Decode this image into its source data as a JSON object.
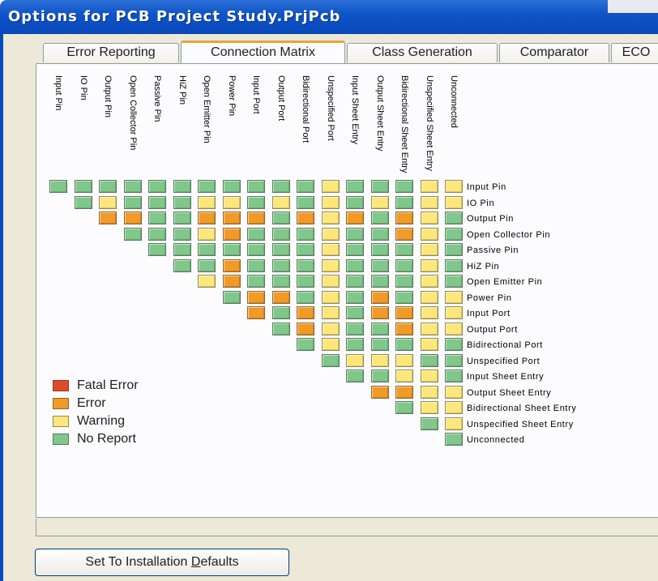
{
  "window": {
    "title": "Options for PCB Project Study.PrjPcb"
  },
  "tabs": [
    {
      "label": "Error Reporting",
      "active": false
    },
    {
      "label": "Connection Matrix",
      "active": true
    },
    {
      "label": "Class Generation",
      "active": false
    },
    {
      "label": "Comparator",
      "active": false
    },
    {
      "label": "ECO",
      "active": false
    }
  ],
  "matrix": {
    "columns": [
      "Input Pin",
      "IO Pin",
      "Output Pin",
      "Open Collector Pin",
      "Passive Pin",
      "HiZ Pin",
      "Open Emitter Pin",
      "Power Pin",
      "Input Port",
      "Output Port",
      "Bidirectional Port",
      "Unspecified Port",
      "Input Sheet Entry",
      "Output Sheet Entry",
      "Bidirectional Sheet Entry",
      "Unspecified Sheet Entry",
      "Unconnected"
    ],
    "rows": [
      "Input Pin",
      "IO Pin",
      "Output Pin",
      "Open Collector Pin",
      "Passive Pin",
      "HiZ Pin",
      "Open Emitter Pin",
      "Power Pin",
      "Input Port",
      "Output Port",
      "Bidirectional Port",
      "Unspecified Port",
      "Input Sheet Entry",
      "Output Sheet Entry",
      "Bidirectional Sheet Entry",
      "Unspecified Sheet Entry",
      "Unconnected"
    ],
    "cells": [
      [
        "N",
        "N",
        "N",
        "N",
        "N",
        "N",
        "N",
        "N",
        "N",
        "N",
        "N",
        "W",
        "N",
        "N",
        "N",
        "W",
        "W"
      ],
      [
        "",
        "N",
        "W",
        "N",
        "N",
        "N",
        "W",
        "W",
        "N",
        "W",
        "N",
        "W",
        "N",
        "W",
        "N",
        "W",
        "W"
      ],
      [
        "",
        "",
        "E",
        "E",
        "N",
        "N",
        "E",
        "E",
        "E",
        "N",
        "E",
        "W",
        "E",
        "N",
        "E",
        "W",
        "N"
      ],
      [
        "",
        "",
        "",
        "N",
        "N",
        "N",
        "W",
        "E",
        "N",
        "N",
        "N",
        "W",
        "N",
        "N",
        "E",
        "W",
        "N"
      ],
      [
        "",
        "",
        "",
        "",
        "N",
        "N",
        "N",
        "N",
        "N",
        "N",
        "N",
        "W",
        "N",
        "N",
        "N",
        "W",
        "N"
      ],
      [
        "",
        "",
        "",
        "",
        "",
        "N",
        "N",
        "E",
        "N",
        "N",
        "N",
        "W",
        "N",
        "N",
        "N",
        "W",
        "N"
      ],
      [
        "",
        "",
        "",
        "",
        "",
        "",
        "W",
        "E",
        "N",
        "N",
        "N",
        "W",
        "N",
        "N",
        "N",
        "W",
        "N"
      ],
      [
        "",
        "",
        "",
        "",
        "",
        "",
        "",
        "N",
        "E",
        "E",
        "N",
        "W",
        "N",
        "E",
        "N",
        "W",
        "W"
      ],
      [
        "",
        "",
        "",
        "",
        "",
        "",
        "",
        "",
        "E",
        "N",
        "E",
        "W",
        "N",
        "E",
        "E",
        "W",
        "W"
      ],
      [
        "",
        "",
        "",
        "",
        "",
        "",
        "",
        "",
        "",
        "N",
        "E",
        "W",
        "N",
        "N",
        "E",
        "W",
        "W"
      ],
      [
        "",
        "",
        "",
        "",
        "",
        "",
        "",
        "",
        "",
        "",
        "N",
        "W",
        "N",
        "N",
        "N",
        "W",
        "N"
      ],
      [
        "",
        "",
        "",
        "",
        "",
        "",
        "",
        "",
        "",
        "",
        "",
        "N",
        "W",
        "W",
        "W",
        "N",
        "N"
      ],
      [
        "",
        "",
        "",
        "",
        "",
        "",
        "",
        "",
        "",
        "",
        "",
        "",
        "N",
        "N",
        "W",
        "W",
        "N"
      ],
      [
        "",
        "",
        "",
        "",
        "",
        "",
        "",
        "",
        "",
        "",
        "",
        "",
        "",
        "E",
        "E",
        "W",
        "W"
      ],
      [
        "",
        "",
        "",
        "",
        "",
        "",
        "",
        "",
        "",
        "",
        "",
        "",
        "",
        "",
        "N",
        "W",
        "W"
      ],
      [
        "",
        "",
        "",
        "",
        "",
        "",
        "",
        "",
        "",
        "",
        "",
        "",
        "",
        "",
        "",
        "N",
        "W"
      ],
      [
        "",
        "",
        "",
        "",
        "",
        "",
        "",
        "",
        "",
        "",
        "",
        "",
        "",
        "",
        "",
        "",
        "N"
      ]
    ]
  },
  "legend": [
    {
      "key": "F",
      "label": "Fatal Error",
      "color": "#e04a2a"
    },
    {
      "key": "E",
      "label": "Error",
      "color": "#f29a26"
    },
    {
      "key": "W",
      "label": "Warning",
      "color": "#fde77a"
    },
    {
      "key": "N",
      "label": "No Report",
      "color": "#7fc78a"
    }
  ],
  "buttons": {
    "defaults": "Set To Installation Defaults"
  }
}
